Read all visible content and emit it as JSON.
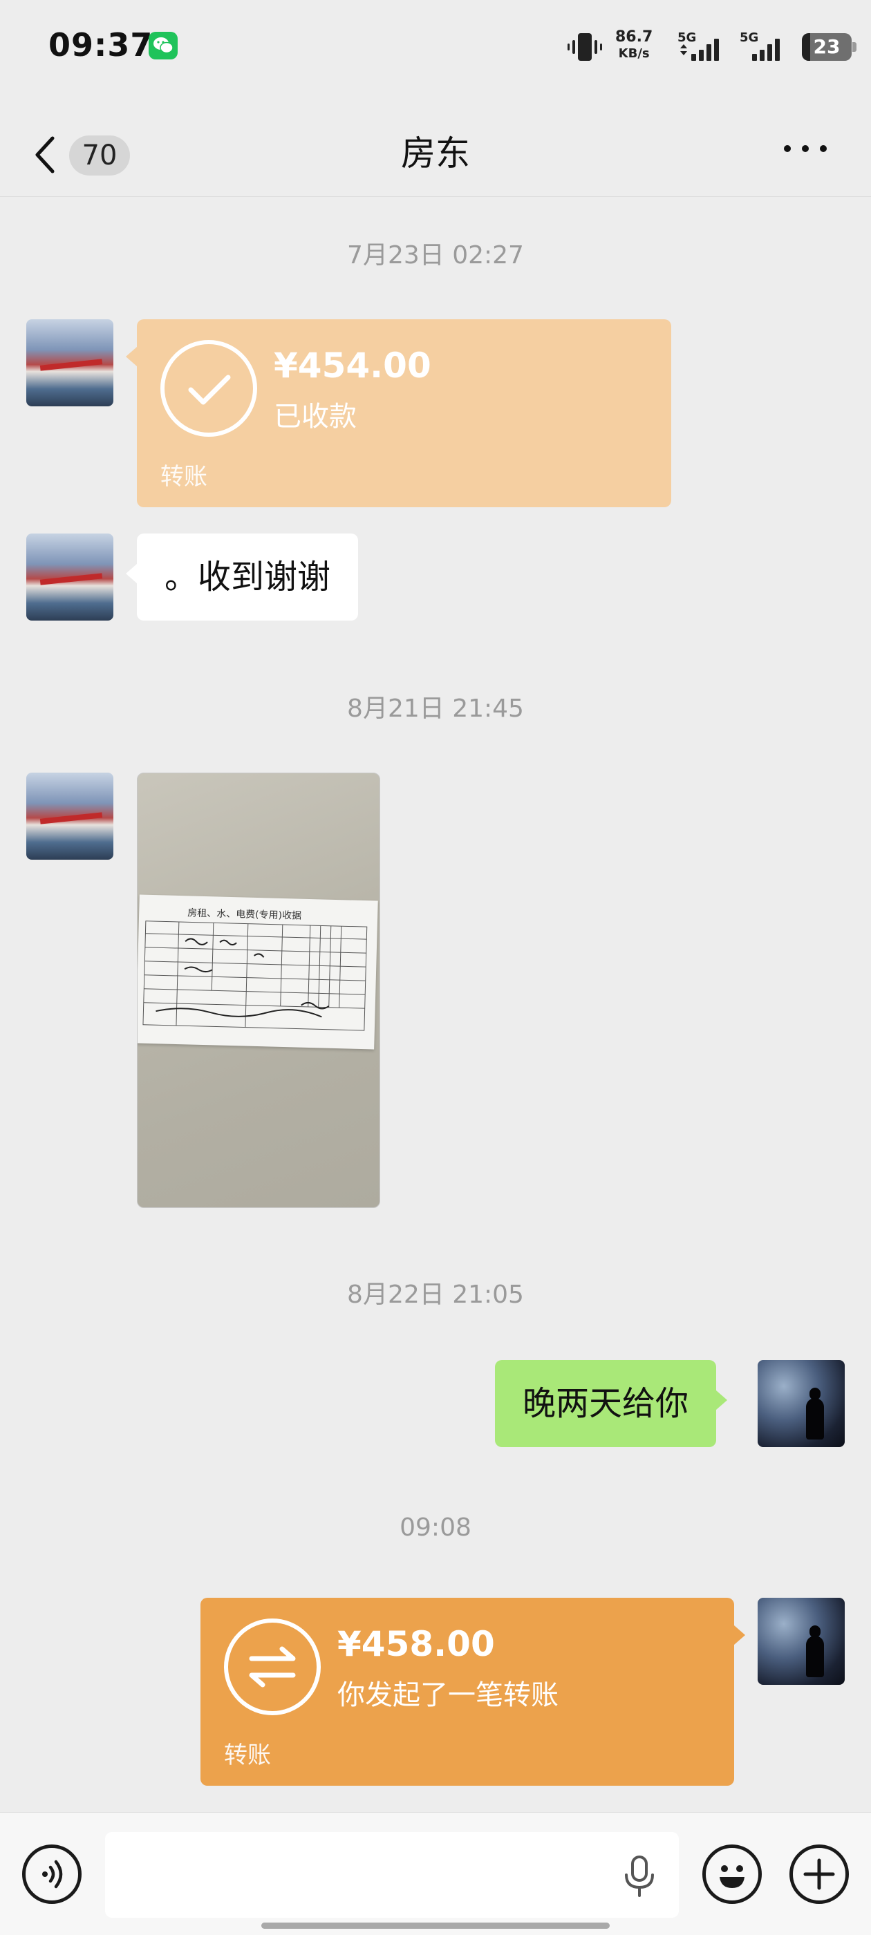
{
  "status_bar": {
    "time": "09:37",
    "net_speed_value": "86.7",
    "net_speed_unit": "KB/s",
    "sim1_label": "5G",
    "sim2_label": "5G",
    "battery": "23"
  },
  "header": {
    "unread_count": "70",
    "title": "房东"
  },
  "messages": [
    {
      "timestamp": "7月23日 02:27"
    },
    {
      "from": "landlord",
      "type": "transfer",
      "amount": "¥454.00",
      "status": "已收款",
      "label": "转账"
    },
    {
      "from": "landlord",
      "type": "text",
      "text": "。收到谢谢"
    },
    {
      "timestamp": "8月21日 21:45"
    },
    {
      "from": "landlord",
      "type": "image",
      "receipt_title": "房租、水、电费(专用)收据"
    },
    {
      "timestamp": "8月22日 21:05"
    },
    {
      "from": "me",
      "type": "text",
      "text": "晚两天给你"
    },
    {
      "timestamp": "09:08"
    },
    {
      "from": "me",
      "type": "transfer",
      "amount": "¥458.00",
      "status": "你发起了一笔转账",
      "label": "转账"
    }
  ],
  "colors": {
    "received_transfer": "#f5cfa1",
    "sent_transfer": "#eca24c",
    "my_bubble": "#a9e878",
    "their_bubble": "#ffffff",
    "background": "#ededed"
  },
  "icons": [
    "back-chevron-icon",
    "more-icon",
    "check-icon",
    "transfer-arrows-icon",
    "voice-icon",
    "microphone-icon",
    "emoji-icon",
    "plus-icon"
  ],
  "input": {
    "value": "",
    "placeholder": ""
  }
}
